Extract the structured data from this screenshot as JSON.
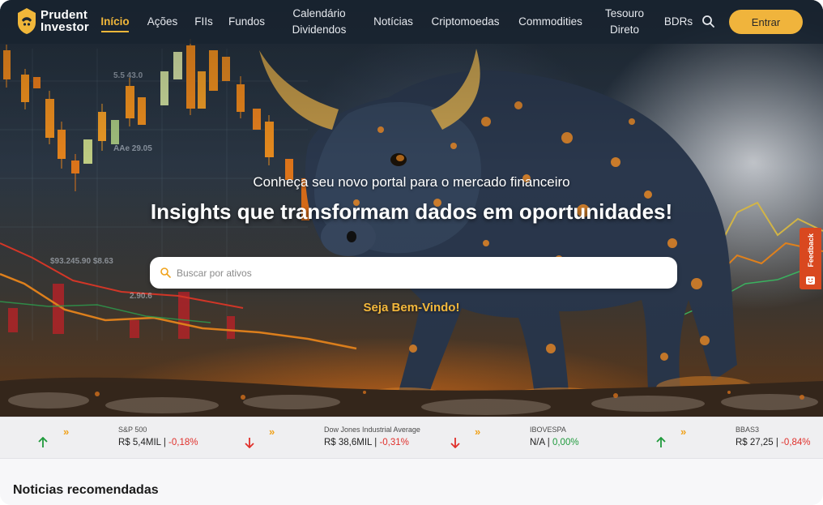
{
  "brand": {
    "line1": "Prudent",
    "line2": "Investor",
    "logo_icon": "prudent-investor-logo"
  },
  "nav": {
    "items": [
      {
        "label": "Início",
        "active": true
      },
      {
        "label": "Ações"
      },
      {
        "label": "FIIs"
      },
      {
        "label": "Fundos"
      },
      {
        "label_line1": "Calendário",
        "label_line2": "Dividendos"
      },
      {
        "label": "Notícias"
      },
      {
        "label": "Criptomoedas"
      },
      {
        "label": "Commodities"
      },
      {
        "label_line1": "Tesouro",
        "label_line2": "Direto"
      },
      {
        "label": "BDRs"
      }
    ],
    "search_icon": "search-icon",
    "login_label": "Entrar"
  },
  "hero": {
    "subtitle": "Conheça seu novo portal para o mercado financeiro",
    "title": "Insights que transformam dados em oportunidades!",
    "search_placeholder": "Buscar por ativos",
    "welcome": "Seja Bem-Vindo!"
  },
  "feedback": {
    "label": "Feedback",
    "icon": "smile-icon"
  },
  "ticker": [
    {
      "direction": "up",
      "name": "S&P 500",
      "price": "R$ 5,4MIL",
      "change": "-0,18%",
      "change_sign": "negative"
    },
    {
      "direction": "down",
      "name": "Dow Jones Industrial Average",
      "price": "R$ 38,6MIL",
      "change": "-0,31%",
      "change_sign": "negative"
    },
    {
      "direction": "down",
      "name": "IBOVESPA",
      "price": "N/A",
      "change": "0,00%",
      "change_sign": "positive"
    },
    {
      "direction": "up",
      "name": "BBAS3",
      "price": "R$ 27,25",
      "change": "-0,84%",
      "change_sign": "negative"
    }
  ],
  "ticker_chevron": "»",
  "ticker_separator": "|",
  "sections": {
    "recommended_news": "Noticias recomendadas"
  },
  "colors": {
    "accent": "#f1b73a",
    "negative": "#e0302b",
    "positive": "#1f9a3c",
    "feedback": "#d9481f",
    "nav_bg": "#1c2631"
  }
}
